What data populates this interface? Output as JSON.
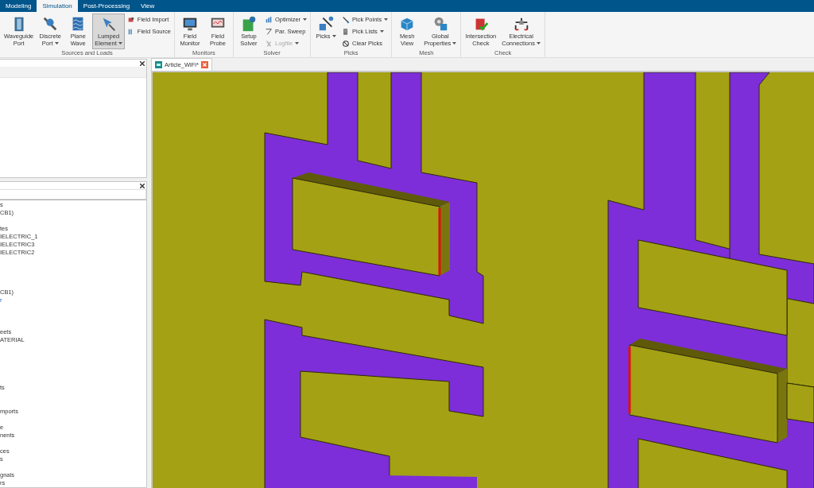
{
  "menu_tabs": [
    {
      "label": "Modeling",
      "selected": false
    },
    {
      "label": "Simulation",
      "selected": true
    },
    {
      "label": "Post-Processing",
      "selected": false
    },
    {
      "label": "View",
      "selected": false
    }
  ],
  "ribbon_groups": [
    {
      "title": "Sources and Loads",
      "items": [
        {
          "kind": "large",
          "lines": [
            "Waveguide",
            "Port"
          ],
          "dropdown": false,
          "pressed": false
        },
        {
          "kind": "large",
          "lines": [
            "Discrete",
            "Port"
          ],
          "dropdown": true,
          "pressed": false
        },
        {
          "kind": "large",
          "lines": [
            "Plane",
            "Wave"
          ],
          "dropdown": false,
          "pressed": false
        },
        {
          "kind": "large",
          "lines": [
            "Lumped",
            "Element"
          ],
          "dropdown": true,
          "pressed": true
        },
        {
          "kind": "stack",
          "items": [
            {
              "label": "Field Import",
              "dropdown": false,
              "disabled": false
            },
            {
              "label": "Field Source",
              "dropdown": false,
              "disabled": false
            }
          ]
        }
      ]
    },
    {
      "title": "Monitors",
      "items": [
        {
          "kind": "large",
          "lines": [
            "Field",
            "Monitor"
          ],
          "dropdown": false,
          "pressed": false
        },
        {
          "kind": "large",
          "lines": [
            "Field",
            "Probe"
          ],
          "dropdown": false,
          "pressed": false
        }
      ]
    },
    {
      "title": "Solver",
      "items": [
        {
          "kind": "large",
          "lines": [
            "Setup",
            "Solver"
          ],
          "dropdown": false,
          "pressed": false
        },
        {
          "kind": "stack",
          "items": [
            {
              "label": "Optimizer",
              "dropdown": true,
              "disabled": false
            },
            {
              "label": "Par. Sweep",
              "dropdown": false,
              "disabled": false
            },
            {
              "label": "Logfile",
              "dropdown": true,
              "disabled": true
            }
          ]
        }
      ]
    },
    {
      "title": "Picks",
      "items": [
        {
          "kind": "large",
          "lines": [
            "Picks"
          ],
          "dropdown": true,
          "pressed": false
        },
        {
          "kind": "stack",
          "items": [
            {
              "label": "Pick Points",
              "dropdown": true,
              "disabled": false
            },
            {
              "label": "Pick Lists",
              "dropdown": true,
              "disabled": false
            },
            {
              "label": "Clear Picks",
              "dropdown": false,
              "disabled": false
            }
          ]
        }
      ]
    },
    {
      "title": "Mesh",
      "items": [
        {
          "kind": "large",
          "lines": [
            "Mesh",
            "View"
          ],
          "dropdown": false,
          "pressed": false
        },
        {
          "kind": "large",
          "lines": [
            "Global",
            "Properties"
          ],
          "dropdown": true,
          "pressed": false
        }
      ]
    },
    {
      "title": "Check",
      "items": [
        {
          "kind": "large",
          "lines": [
            "Intersection",
            "Check"
          ],
          "dropdown": false,
          "pressed": false
        },
        {
          "kind": "large",
          "lines": [
            "Electrical",
            "Connections"
          ],
          "dropdown": true,
          "pressed": false
        }
      ]
    }
  ],
  "tree_rows": [
    {
      "label": "s",
      "link": false
    },
    {
      "label": "CB1)",
      "link": false
    },
    {
      "label": "tes",
      "link": false
    },
    {
      "label": "IELECTRIC_1",
      "link": false
    },
    {
      "label": "IELECTRIC3",
      "link": false
    },
    {
      "label": "IELECTRIC2",
      "link": false
    },
    {
      "label": "CB1)",
      "link": false
    },
    {
      "label": "r",
      "link": true
    },
    {
      "label": "eets",
      "link": false
    },
    {
      "label": "ATERIAL",
      "link": false
    },
    {
      "label": "ts",
      "link": false
    },
    {
      "label": "mports",
      "link": false
    },
    {
      "label": "e",
      "link": false
    },
    {
      "label": "nents",
      "link": false
    },
    {
      "label": "ces",
      "link": false
    },
    {
      "label": "s",
      "link": false
    },
    {
      "label": "gnals",
      "link": false
    },
    {
      "label": "rs",
      "link": false
    }
  ],
  "document_tab": {
    "label": "Article_WiFi*",
    "selected": true
  }
}
